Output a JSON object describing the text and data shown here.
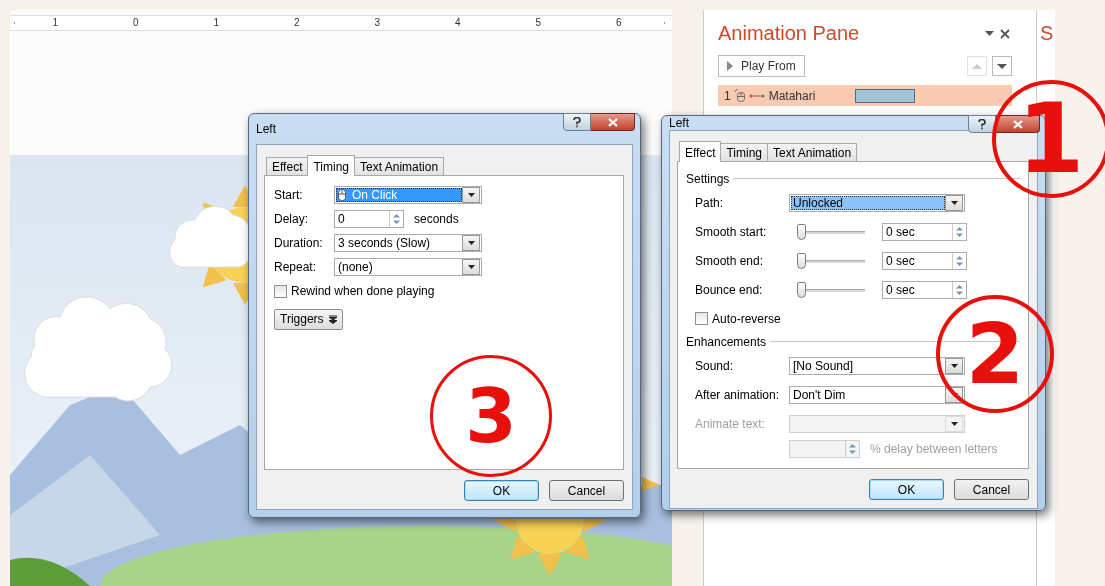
{
  "ruler": {
    "labels": [
      "1",
      "0",
      "1",
      "2",
      "3",
      "4",
      "5",
      "6"
    ]
  },
  "animation_pane": {
    "title": "Animation Pane",
    "play_button": "Play From",
    "items": [
      {
        "number": "1",
        "name": "Matahari",
        "selected": true
      }
    ]
  },
  "next_pane": {
    "title": "S"
  },
  "timing_dialog": {
    "title": "Left",
    "tabs": [
      {
        "label": "Effect",
        "selected": false
      },
      {
        "label": "Timing",
        "selected": true
      },
      {
        "label": "Text Animation",
        "selected": false
      }
    ],
    "rows": [
      {
        "kind": "dropdown",
        "label": "Start:",
        "value": "On Click",
        "focused": true
      },
      {
        "kind": "spinner",
        "label": "Delay:",
        "value": "0",
        "unit": "seconds"
      },
      {
        "kind": "dropdown",
        "label": "Duration:",
        "value": "3 seconds (Slow)",
        "focused": false
      },
      {
        "kind": "dropdown",
        "label": "Repeat:",
        "value": "(none)",
        "focused": false
      },
      {
        "kind": "checkbox",
        "label": "Rewind when done playing",
        "checked": false
      },
      {
        "kind": "button",
        "label": "Triggers"
      }
    ],
    "buttons": [
      "OK",
      "Cancel"
    ]
  },
  "effect_dialog": {
    "title": "Left",
    "tabs": [
      {
        "label": "Effect",
        "selected": true
      },
      {
        "label": "Timing",
        "selected": false
      },
      {
        "label": "Text Animation",
        "selected": false
      }
    ],
    "groups": [
      {
        "title": "Settings",
        "rows": [
          {
            "kind": "dropdown",
            "label": "Path:",
            "value": "Unlocked",
            "focused": true,
            "disabled": false
          },
          {
            "kind": "slider",
            "label": "Smooth start:",
            "level": 0,
            "value": "0 sec"
          },
          {
            "kind": "slider",
            "label": "Smooth end:",
            "level": 0,
            "value": "0 sec"
          },
          {
            "kind": "slider",
            "label": "Bounce end:",
            "level": 0,
            "value": "0 sec"
          },
          {
            "kind": "checkbox",
            "label": "Auto-reverse",
            "checked": false
          }
        ]
      },
      {
        "title": "Enhancements",
        "rows": [
          {
            "kind": "dropdown",
            "label": "Sound:",
            "value": "[No Sound]",
            "focused": false,
            "disabled": false
          },
          {
            "kind": "dropdown",
            "label": "After animation:",
            "value": "Don't Dim",
            "focused": false,
            "disabled": false
          },
          {
            "kind": "dropdown",
            "label": "Animate text:",
            "focused": false,
            "disabled": true
          },
          {
            "kind": "spinner",
            "unit": "% delay between letters",
            "disabled": true
          }
        ]
      }
    ],
    "buttons": [
      "OK",
      "Cancel"
    ]
  },
  "annotations": [
    "1",
    "2",
    "3"
  ]
}
